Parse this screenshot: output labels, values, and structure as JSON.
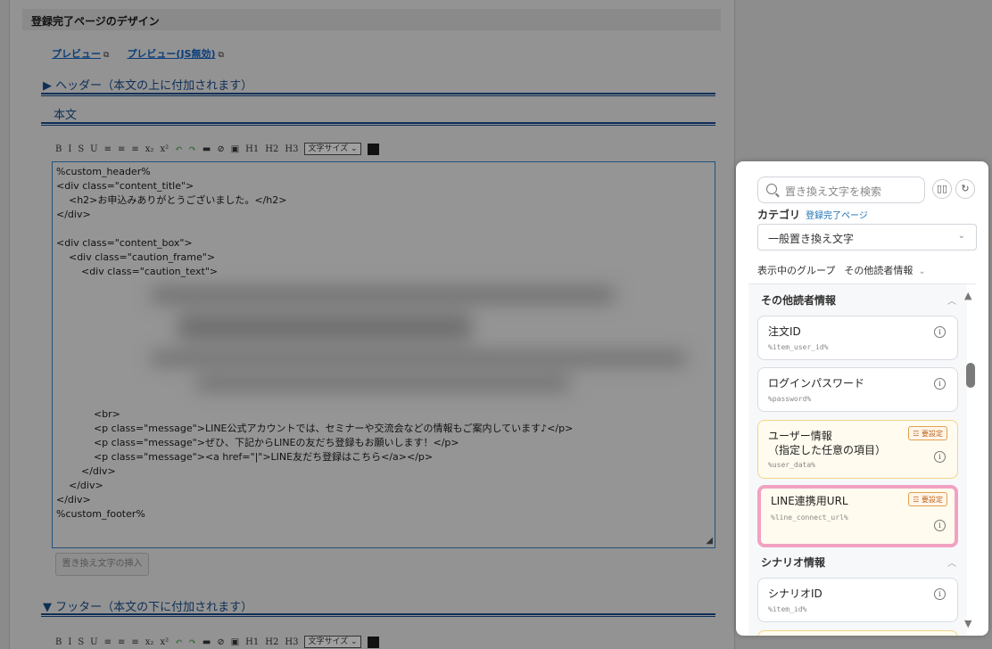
{
  "page": {
    "title": "登録完了ページのデザイン",
    "preview_links": [
      "プレビュー",
      "プレビュー(JS無効)"
    ],
    "external_icon": "⧉",
    "header_section": "▶ ヘッダー（本文の上に付加されます）",
    "body_section": "本文",
    "footer_section": "▼ フッター（本文の下に付加されます）",
    "toolbar": {
      "buttons": [
        "B",
        "I",
        "S",
        "U",
        "≡",
        "≡",
        "≡",
        "x₂",
        "x²",
        "↶",
        "↷",
        "▬",
        "⊘",
        "▣",
        "H1",
        "H2",
        "H3"
      ],
      "font_size_select": "文字サイズ ⌄"
    },
    "editor_lines": [
      "%custom_header%",
      "<div class=\"content_title\">",
      "    <h2>お申込みありがとうございました。</h2>",
      "</div>",
      "",
      "<div class=\"content_box\">",
      "    <div class=\"caution_frame\">",
      "        <div class=\"caution_text\">"
    ],
    "editor_lines_after": [
      "            <br>",
      "            <p class=\"message\">LINE公式アカウントでは、セミナーや交流会などの情報もご案内しています♪</p>",
      "            <p class=\"message\">ぜひ、下記からLINEの友だち登録もお願いします！</p>",
      "            <p class=\"message\"><a href=\"|\">LINE友だち登録はこちら</a></p>",
      "        </div>",
      "    </div>",
      "</div>",
      "%custom_footer%"
    ],
    "insert_button": "置き換え文字の挿入"
  },
  "panel": {
    "search_placeholder": "置き換え文字を検索",
    "icons": [
      "book-icon",
      "refresh-icon"
    ],
    "book_glyph": "▯▯",
    "refresh_glyph": "↻",
    "category_label": "カテゴリ",
    "category_value": "登録完了ページ",
    "select_value": "一般置き換え文字",
    "group_label": "表示中のグループ",
    "group_value": "その他読者情報",
    "groups": [
      {
        "title": "その他読者情報",
        "items": [
          {
            "title": "注文ID",
            "code": "%item_user_id%",
            "required": false
          },
          {
            "title": "ログインパスワード",
            "code": "%password%",
            "required": false
          },
          {
            "title": "ユーザー情報\n（指定した任意の項目）",
            "code": "%user_data%",
            "required": true
          },
          {
            "title": "LINE連携用URL",
            "code": "%line_connect_url%",
            "required": true,
            "highlighted": true
          }
        ]
      },
      {
        "title": "シナリオ情報",
        "items": [
          {
            "title": "シナリオID",
            "code": "%item_id%",
            "required": false
          }
        ]
      }
    ],
    "required_badge": "☲ 要設定",
    "info_glyph": "i"
  }
}
